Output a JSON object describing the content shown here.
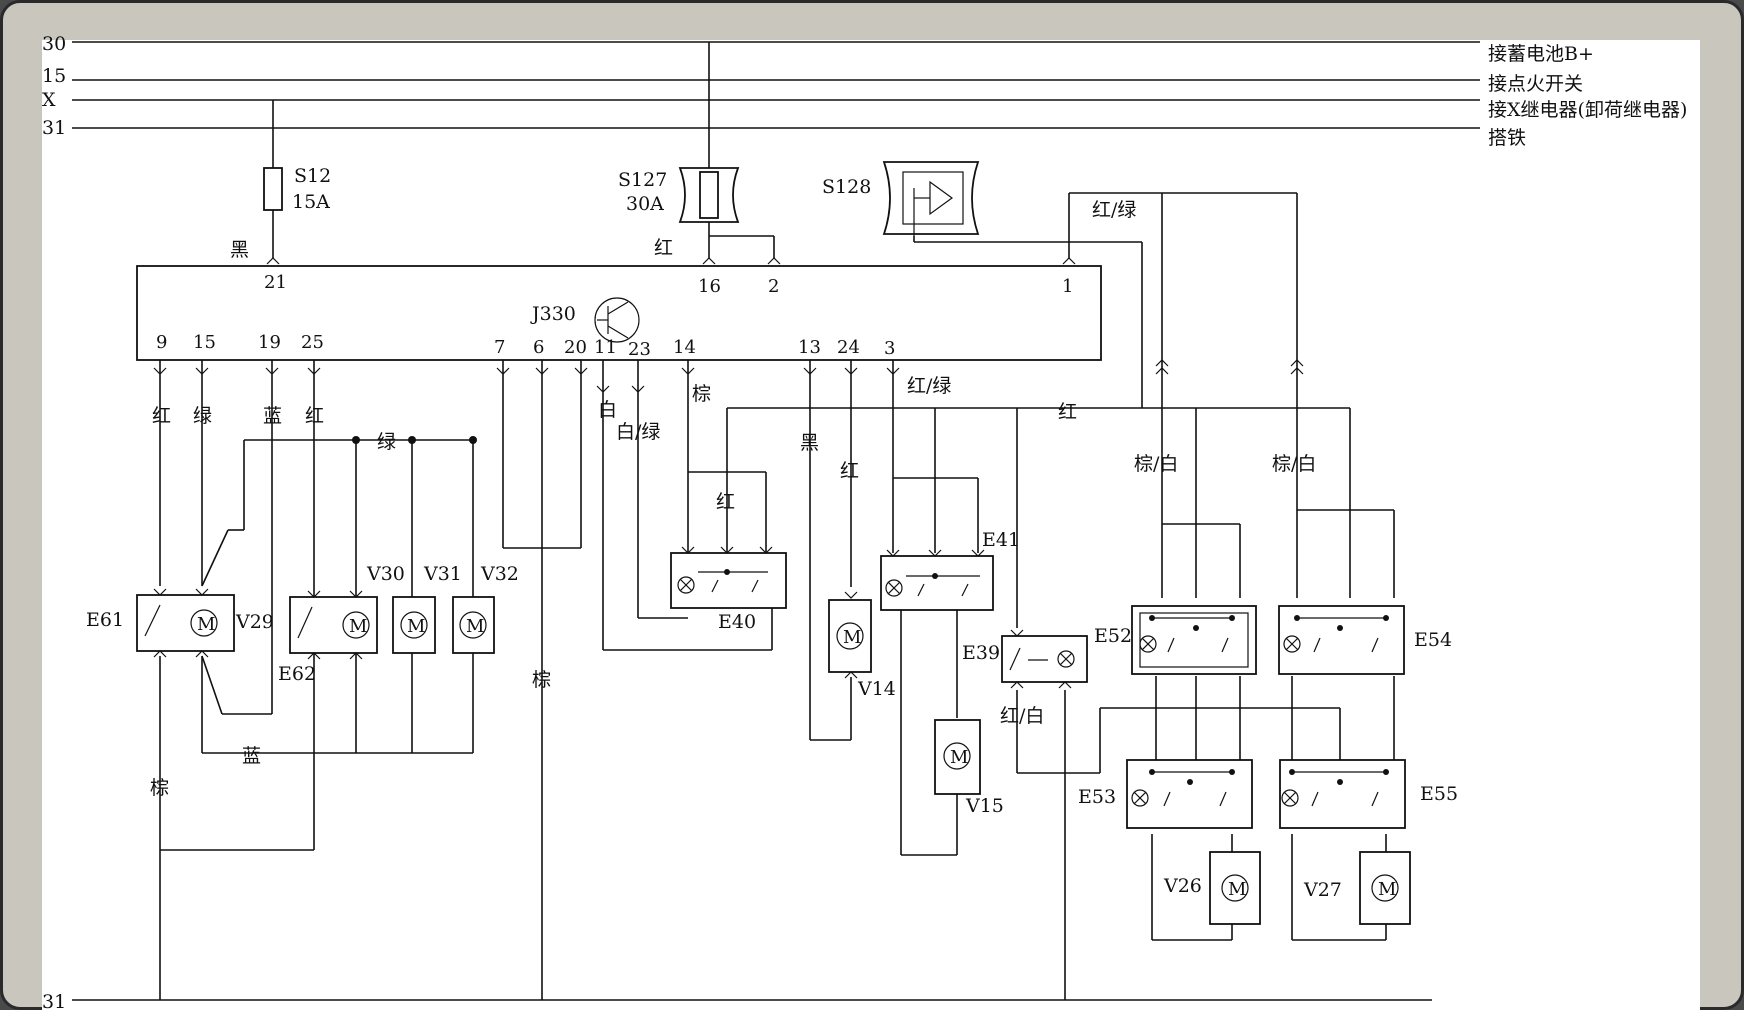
{
  "buses": [
    {
      "name": "30",
      "desc": "接蓄电池B+"
    },
    {
      "name": "15",
      "desc": "接点火开关"
    },
    {
      "name": "X",
      "desc": "接X继电器(卸荷继电器)"
    },
    {
      "name": "31",
      "desc": "搭铁"
    }
  ],
  "bottom_bus": "31",
  "fuses": {
    "s12": {
      "name": "S12",
      "rating": "15A"
    },
    "s127": {
      "name": "S127",
      "rating": "30A"
    },
    "s128": {
      "name": "S128"
    }
  },
  "module": {
    "name": "J330"
  },
  "pins_top": [
    "21",
    "16",
    "2",
    "1"
  ],
  "pins_bottom": [
    "9",
    "15",
    "19",
    "25",
    "7",
    "6",
    "20",
    "11",
    "23",
    "14",
    "13",
    "24",
    "3"
  ],
  "wire_colors": {
    "hei": "黑",
    "hong": "红",
    "lv": "绿",
    "lan": "蓝",
    "bai": "白",
    "zong": "棕",
    "hong_lv": "红/绿",
    "bai_lv": "白/绿",
    "zong_bai": "棕/白",
    "hong_bai": "红/白"
  },
  "components": {
    "E39": "E39",
    "E40": "E40",
    "E41": "E41",
    "E52": "E52",
    "E53": "E53",
    "E54": "E54",
    "E55": "E55",
    "E61": "E61",
    "E62": "E62",
    "V14": "V14",
    "V15": "V15",
    "V26": "V26",
    "V27": "V27",
    "V29": "V29",
    "V30": "V30",
    "V31": "V31",
    "V32": "V32"
  },
  "motor_symbol": "M"
}
